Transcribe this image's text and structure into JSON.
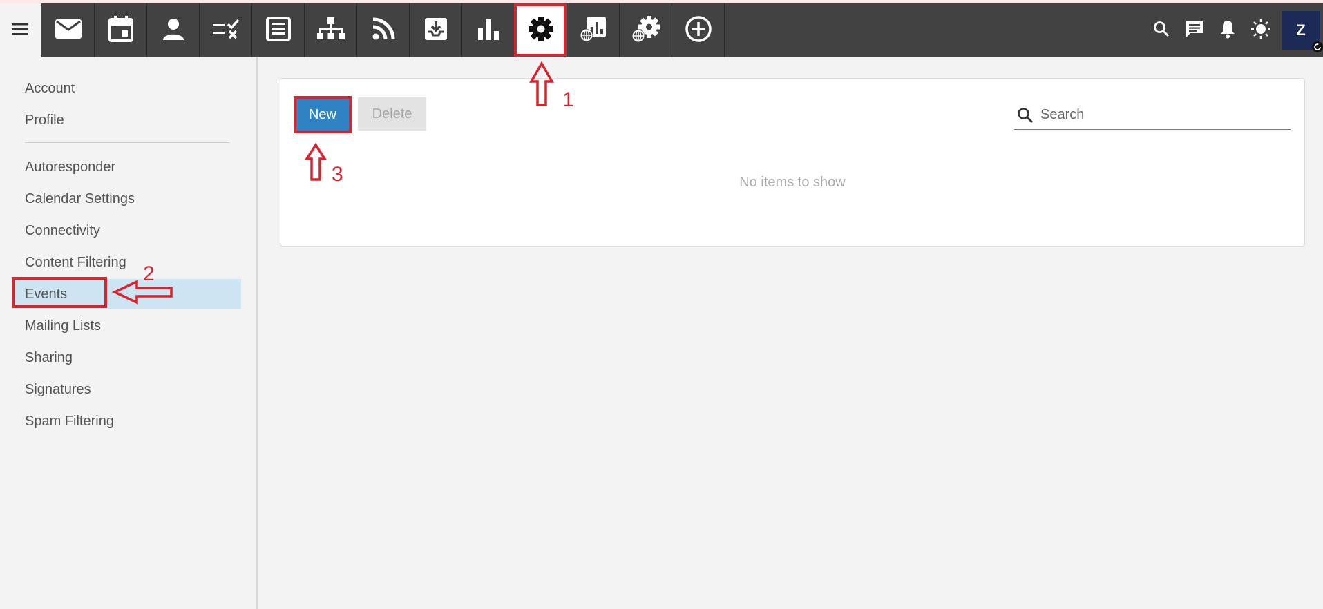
{
  "icons": {
    "menu": "hamburger-menu-icon",
    "nav": [
      "mail-icon",
      "calendar-icon",
      "contacts-icon",
      "tasks-icon",
      "notes-icon",
      "org-chart-icon",
      "rss-icon",
      "inbox-download-icon",
      "bar-chart-icon",
      "settings-gear-icon",
      "domain-reports-icon",
      "domain-settings-icon",
      "add-circle-icon"
    ],
    "right": [
      "search-icon",
      "chat-icon",
      "bell-icon",
      "brightness-icon"
    ]
  },
  "user": {
    "avatar_letter": "Z"
  },
  "sidebar": {
    "group1": [
      "Account",
      "Profile"
    ],
    "group2": [
      "Autoresponder",
      "Calendar Settings",
      "Connectivity",
      "Content Filtering",
      "Events",
      "Mailing Lists",
      "Sharing",
      "Signatures",
      "Spam Filtering"
    ],
    "selected": "Events"
  },
  "toolbar": {
    "new_label": "New",
    "delete_label": "Delete"
  },
  "search": {
    "placeholder": "Search"
  },
  "list": {
    "empty_message": "No items to show"
  },
  "annotations": {
    "step1": "1",
    "step2": "2",
    "step3": "3"
  },
  "colors": {
    "topbar": "#424242",
    "primary_button": "#2f83c3",
    "selected_item": "#cde5f3",
    "annotation_red": "#d9232d",
    "avatar": "#1c2a57"
  }
}
